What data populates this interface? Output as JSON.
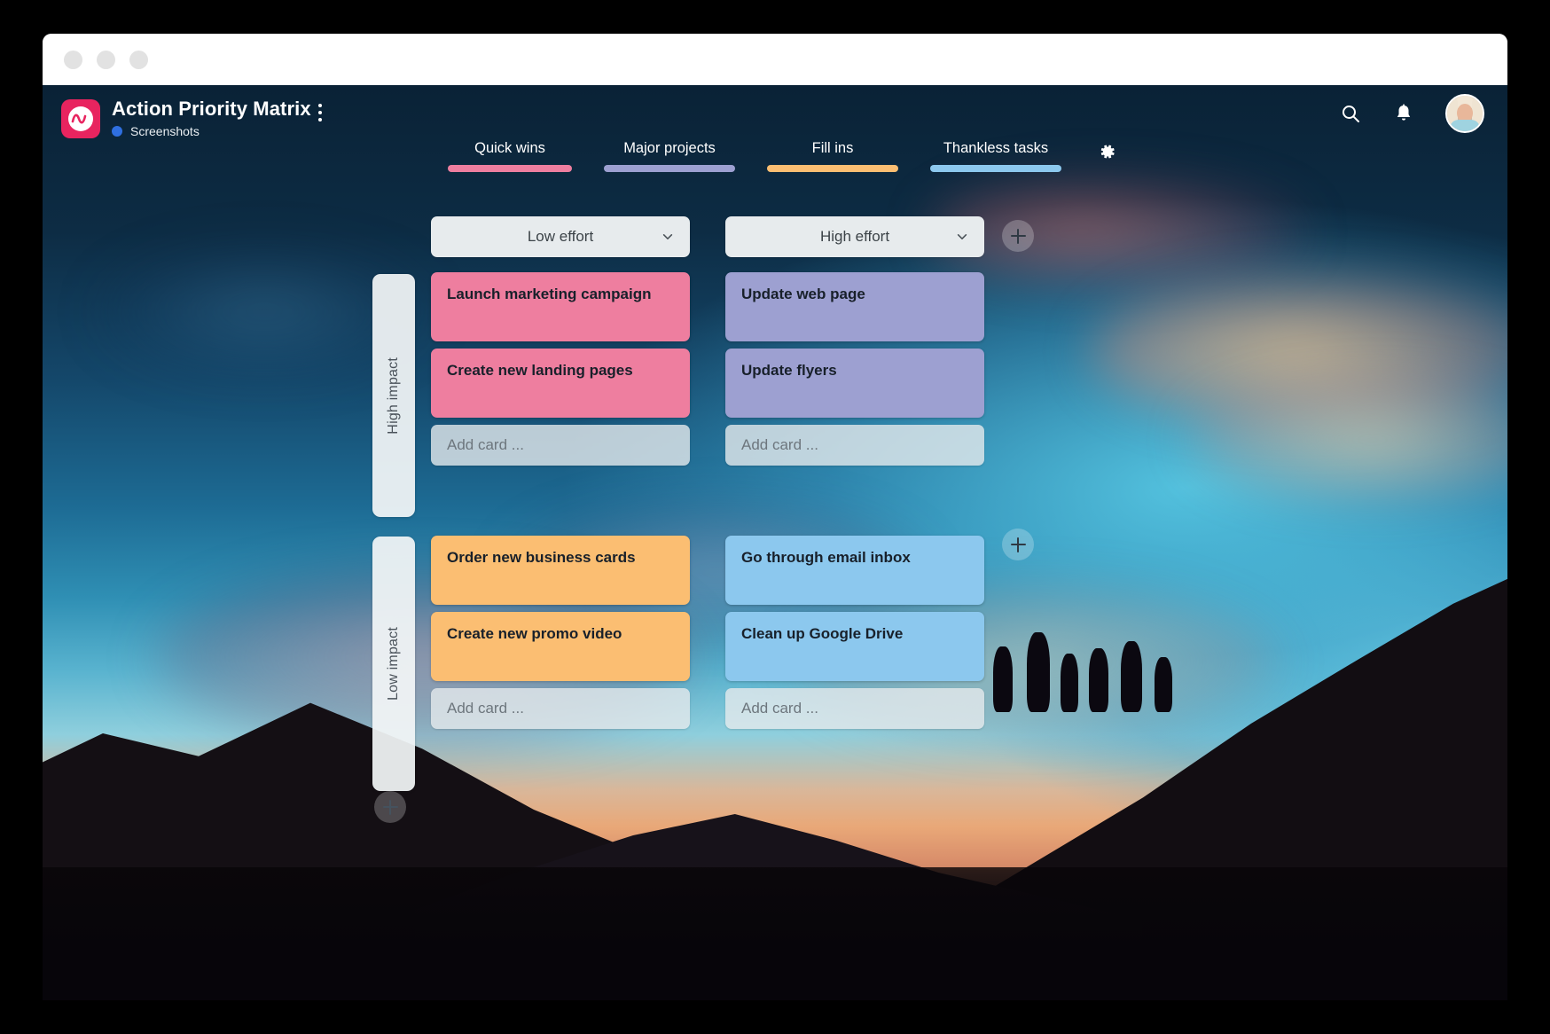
{
  "window": {
    "controls": [
      "close-dot",
      "minimize-dot",
      "maximize-dot"
    ]
  },
  "header": {
    "logo_icon": "wave-logo-icon",
    "title": "Action Priority Matrix",
    "menu_icon": "kebab-menu-icon",
    "workspace_dot_color": "#2f6fe0",
    "workspace": "Screenshots",
    "search_icon": "search-icon",
    "notifications_icon": "bell-icon",
    "avatar_icon": "user-avatar"
  },
  "tabs": {
    "settings_icon": "gear-icon",
    "items": [
      {
        "label": "Quick wins",
        "color": "#EE7E9F"
      },
      {
        "label": "Major projects",
        "color": "#9DA0D1"
      },
      {
        "label": "Fill ins",
        "color": "#FBBE72"
      },
      {
        "label": "Thankless tasks",
        "color": "#8CC8EE"
      }
    ]
  },
  "matrix": {
    "columns": [
      {
        "label": "Low effort",
        "chevron_icon": "chevron-down-icon"
      },
      {
        "label": "High effort",
        "chevron_icon": "chevron-down-icon"
      }
    ],
    "rows": [
      {
        "label": "High impact"
      },
      {
        "label": "Low impact"
      }
    ],
    "add_card_placeholder": "Add card ...",
    "add_column_button": "add-column-button",
    "add_row_button": "add-row-button",
    "add_lane_button": "add-lane-button",
    "cells": [
      {
        "row": "High impact",
        "column": "Low effort",
        "color": "#EE7E9F",
        "cards": [
          "Launch marketing campaign",
          "Create new landing pages"
        ]
      },
      {
        "row": "High impact",
        "column": "High effort",
        "color": "#9DA0D1",
        "cards": [
          "Update web page",
          "Update flyers"
        ]
      },
      {
        "row": "Low impact",
        "column": "Low effort",
        "color": "#FBBE72",
        "cards": [
          "Order new business cards",
          "Create new promo video"
        ]
      },
      {
        "row": "Low impact",
        "column": "High effort",
        "color": "#8CC8EE",
        "cards": [
          "Go through email inbox",
          "Clean up Google Drive"
        ]
      }
    ]
  }
}
